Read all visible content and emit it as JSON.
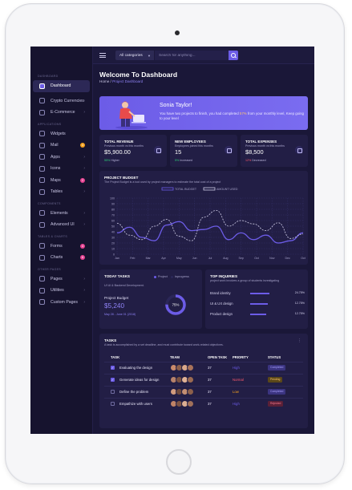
{
  "sidebar": {
    "sections": [
      "DASHBOARD",
      "APPLICATIONS",
      "COMPONENTS",
      "TABLES & CHARTS",
      "OTHER PAGES"
    ],
    "items": [
      {
        "label": "Dashboard",
        "active": true
      },
      {
        "label": "Crypto Currencies"
      },
      {
        "label": "E-Commerce"
      },
      {
        "label": "Widgets"
      },
      {
        "label": "Mail",
        "badge": "4",
        "badge_color": "#f6a21e"
      },
      {
        "label": "Apps"
      },
      {
        "label": "Icons"
      },
      {
        "label": "Maps",
        "badge": "2",
        "badge_color": "#e84393"
      },
      {
        "label": "Tables"
      },
      {
        "label": "Elements"
      },
      {
        "label": "Advanced UI"
      },
      {
        "label": "Forms",
        "badge": "4",
        "badge_color": "#e84393"
      },
      {
        "label": "Charts",
        "badge": "6",
        "badge_color": "#e84393"
      },
      {
        "label": "Pages"
      },
      {
        "label": "Utilities"
      },
      {
        "label": "Custom Pages"
      }
    ]
  },
  "topbar": {
    "category": "All categories",
    "search_placeholder": "Search for anything..."
  },
  "header": {
    "title": "Welcome To Dashboard",
    "breadcrumb_home": "Home",
    "breadcrumb_sep": "/",
    "breadcrumb_current": "Project Dashboard"
  },
  "welcome": {
    "name": "Sonia Taylor!",
    "text_a": "You have two projects to finish, you had completed ",
    "text_pct": "57%",
    "text_b": " from your monthly level, Keep going to your level"
  },
  "stats": [
    {
      "title": "TOTAL REVENUE",
      "sub": "Previous month vs this months",
      "value": "$5,900.00",
      "change": "55%",
      "change_text": "Higher",
      "change_color": "#2ed47a"
    },
    {
      "title": "NEW EMPLOYEES",
      "sub": "Employees joined this months",
      "value": "15",
      "change": "5%",
      "change_text": "Increased",
      "change_color": "#2ed47a"
    },
    {
      "title": "TOTAL EXPENSES",
      "sub": "Previous month vs this months",
      "value": "$8,500",
      "change": "12%",
      "change_text": "Decreased",
      "change_color": "#ff5b6e"
    }
  ],
  "budget": {
    "title": "PROJECT BUDGET",
    "sub": "The Project Budget is a tool used by project managers to estimate the total cost of a project",
    "legend": [
      "TOTAL BUDGET",
      "AMOUNT USED"
    ]
  },
  "chart_data": {
    "type": "line",
    "categories": [
      "Jan",
      "Feb",
      "Mar",
      "Apr",
      "May",
      "Jun",
      "Jul",
      "Aug",
      "Sep",
      "Oct",
      "Nov",
      "Dec",
      "Oct"
    ],
    "ylim": [
      0,
      100
    ],
    "yticks": [
      0,
      10,
      20,
      30,
      40,
      50,
      60,
      70,
      80,
      90,
      100
    ],
    "grid": true,
    "series": [
      {
        "name": "TOTAL BUDGET",
        "color": "#6c5ce7",
        "style": "solid",
        "values": [
          38,
          48,
          30,
          24,
          52,
          58,
          42,
          44,
          50,
          26,
          38,
          26,
          34,
          20,
          24,
          38
        ]
      },
      {
        "name": "AMOUNT USED",
        "color": "#d0cde8",
        "style": "dashed",
        "values": [
          55,
          34,
          26,
          50,
          62,
          32,
          24,
          66,
          78,
          50,
          60,
          54,
          42,
          56,
          28,
          36
        ]
      }
    ]
  },
  "today_tasks": {
    "title": "TODAY TASKS",
    "legend_project": "Project",
    "legend_inprogress": "Inprogress",
    "sub": "UI UI & Backend Development.",
    "label": "Project Budget",
    "value": "$5,240",
    "date": "May 28 - June 01 (2018)",
    "percent": "75%",
    "percent_value": 75
  },
  "inquiries": {
    "title": "TOP INQUIRIES",
    "sub": "project work involves a group of students investigating",
    "rows": [
      {
        "label": "Brand identity",
        "pct": "24.75%",
        "value": 60
      },
      {
        "label": "UI & UX design",
        "pct": "12.75%",
        "value": 55
      },
      {
        "label": "Product design",
        "pct": "12.75%",
        "value": 50
      }
    ]
  },
  "tasks": {
    "title": "TASKS",
    "sub": "A task is accomplished by a set deadline, and must contribute toward work-related objectives.",
    "menu": "⋮",
    "headers": {
      "task": "TASK",
      "team": "TEAM",
      "open": "OPEN TASK",
      "priority": "PRIORITY",
      "status": "STATUS"
    },
    "rows": [
      {
        "name": "Evaluating the design",
        "open": "37",
        "priority": "High",
        "priority_color": "#6c5ce7",
        "status": "Completed",
        "status_bg": "#3b3480",
        "status_fg": "#a9a0ff",
        "checked": true
      },
      {
        "name": "Generate ideas for design",
        "open": "37",
        "priority": "Normal",
        "priority_color": "#ff5b6e",
        "status": "Pending",
        "status_bg": "#5a4719",
        "status_fg": "#ffc46b",
        "checked": true
      },
      {
        "name": "Define the problem",
        "open": "37",
        "priority": "Low",
        "priority_color": "#f6a21e",
        "status": "Completed",
        "status_bg": "#3b3480",
        "status_fg": "#a9a0ff",
        "checked": false
      },
      {
        "name": "Empathize with users",
        "open": "37",
        "priority": "High",
        "priority_color": "#6c5ce7",
        "status": "Rejected",
        "status_bg": "#5a2037",
        "status_fg": "#ff7b8e",
        "checked": false
      }
    ]
  }
}
